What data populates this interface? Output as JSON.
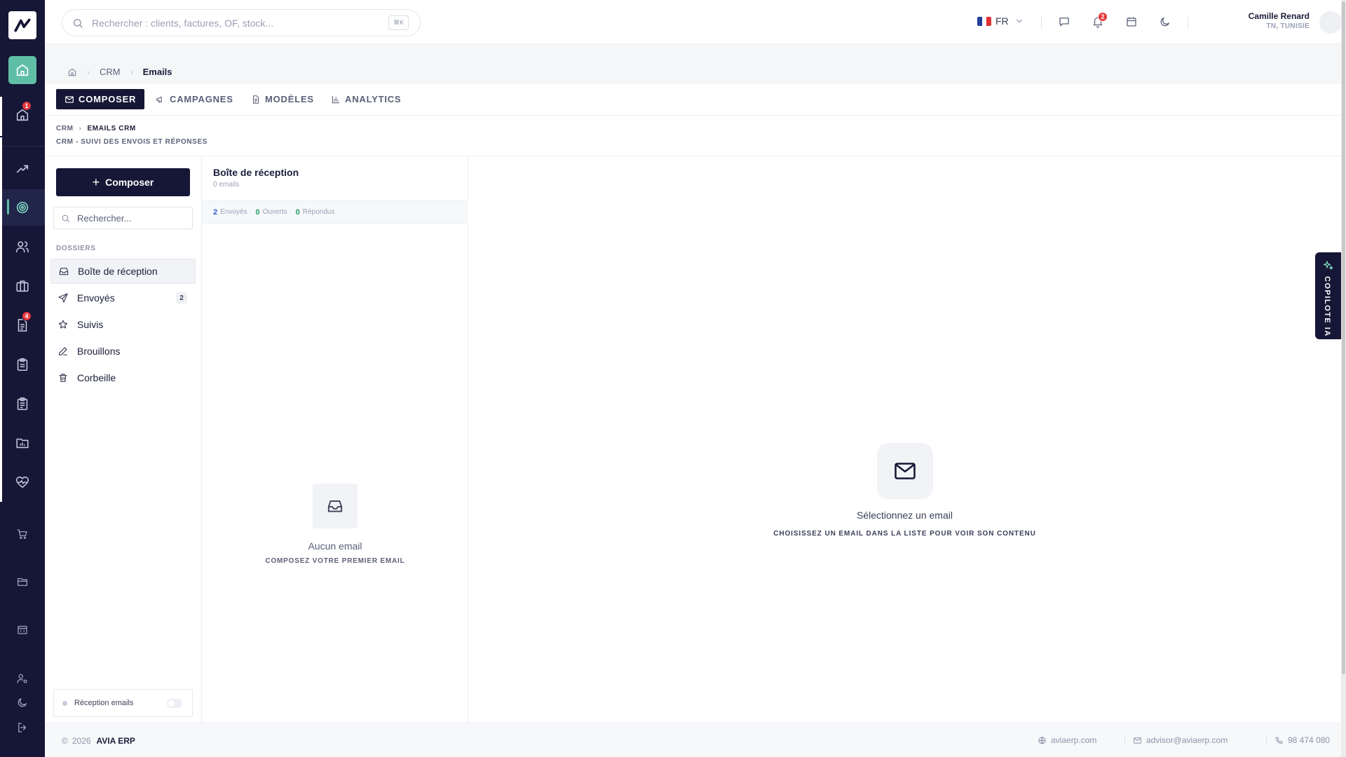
{
  "topbar": {
    "search_placeholder": "Rechercher : clients, factures, OF, stock...",
    "search_shortcut": "⌘K",
    "language": "FR",
    "notifications_count": "2",
    "user_name": "Camille Renard",
    "user_location": "TN, TUNISIE"
  },
  "rail": {
    "badge_home": "1",
    "badge_docs": "4"
  },
  "breadcrumb": {
    "level1": "CRM",
    "current": "Emails"
  },
  "tabs": [
    {
      "label": "COMPOSER"
    },
    {
      "label": "CAMPAGNES"
    },
    {
      "label": "MODÈLES"
    },
    {
      "label": "ANALYTICS"
    }
  ],
  "subheader": {
    "crumb_parent": "CRM",
    "crumb_current": "EMAILS CRM",
    "description": "CRM - SUIVI DES ENVOIS ET RÉPONSES"
  },
  "folders_panel": {
    "compose_label": "Composer",
    "search_placeholder": "Rechercher...",
    "section_label": "DOSSIERS",
    "items": [
      {
        "label": "Boîte de réception",
        "count": ""
      },
      {
        "label": "Envoyés",
        "count": "2"
      },
      {
        "label": "Suivis",
        "count": ""
      },
      {
        "label": "Brouillons",
        "count": ""
      },
      {
        "label": "Corbeille",
        "count": ""
      }
    ],
    "reception_label": "Réception emails"
  },
  "list_panel": {
    "title": "Boîte de réception",
    "count_text": "0 emails",
    "stats": [
      {
        "value": "2",
        "label": "Envoyés",
        "color": "#2f5bd3"
      },
      {
        "value": "0",
        "label": "Ouverts",
        "color": "#1f9d6b"
      },
      {
        "value": "0",
        "label": "Répondus",
        "color": "#1f9d6b"
      }
    ],
    "empty_title": "Aucun email",
    "empty_subtitle": "COMPOSEZ VOTRE PREMIER EMAIL"
  },
  "preview": {
    "title": "Sélectionnez un email",
    "subtitle": "CHOISISSEZ UN EMAIL DANS LA LISTE POUR VOIR SON CONTENU"
  },
  "copilot": {
    "label": "COPILOTE IA"
  },
  "footer": {
    "year": "2026",
    "brand": "AVIA ERP",
    "website": "aviaerp.com",
    "email": "advisor@aviaerp.com",
    "phone": "98 474 080"
  },
  "colors": {
    "navy": "#161636",
    "accent": "#5fbfa6",
    "badge": "#e5363d"
  }
}
